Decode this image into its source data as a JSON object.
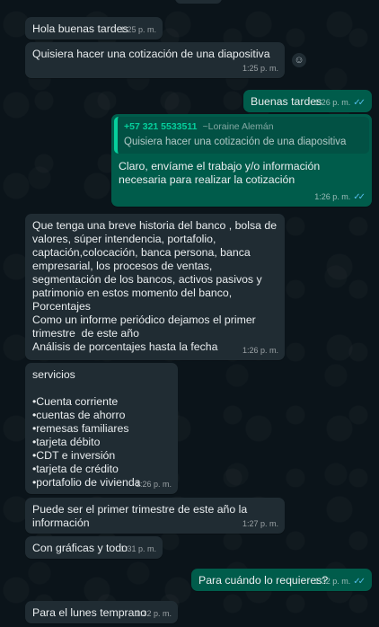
{
  "messages": [
    {
      "text": "Hola buenas tardes",
      "time": "1:25 p. m."
    },
    {
      "text": "Quisiera hacer una cotización de una diapositiva",
      "time": "1:25 p. m."
    },
    {
      "text": "Buenas tardes",
      "time": "1:26 p. m."
    },
    {
      "quote_author": "+57 321 5533511",
      "quote_alias": "~Loraine Alemán",
      "quote_text": "Quisiera hacer una cotización de una diapositiva",
      "text": "Claro, envíame el trabajo y/o información necesaria para realizar la cotización",
      "time": "1:26 p. m."
    },
    {
      "text": "Que tenga una breve historia del banco , bolsa de valores, súper intendencia, portafolio, captación,colocación, banca persona, banca empresarial, los procesos de ventas, segmentación de los bancos, activos pasivos y patrimonio en estos momento del banco,\nPorcentajes\nComo un informe periódico dejamos el primer trimestre  de este año\nAnálisis de porcentajes hasta la fecha",
      "time": "1:26 p. m."
    },
    {
      "text": "servicios\n\n•Cuenta corriente\n•cuentas de ahorro\n•remesas familiares\n•tarjeta débito\n•CDT e inversión\n•tarjeta de crédito\n•portafolio de vivienda",
      "time": "1:26 p. m."
    },
    {
      "text": "Puede ser el primer trimestre de este año la información",
      "time": "1:27 p. m."
    },
    {
      "text": "Con gráficas y todo",
      "time": "1:31 p. m."
    },
    {
      "text": "Para cuándo lo requieres?",
      "time": "1:32 p. m."
    },
    {
      "text": "Para el lunes temprano",
      "time": "1:32 p. m."
    }
  ],
  "icons": {
    "read_receipt": "double-check-icon",
    "react": "emoji-icon"
  },
  "colors": {
    "background": "#0b141a",
    "incoming": "#202c33",
    "outgoing": "#005c4b",
    "read_ticks": "#53bdeb"
  }
}
